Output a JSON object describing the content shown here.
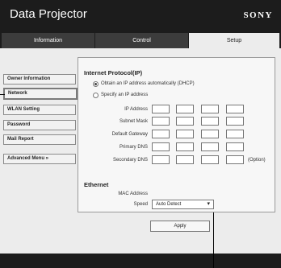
{
  "app": {
    "title": "Data Projector",
    "brand": "SONY"
  },
  "tabs": [
    {
      "label": "Information"
    },
    {
      "label": "Control"
    },
    {
      "label": "Setup"
    }
  ],
  "sidebar": {
    "items": [
      {
        "label": "Owner Information"
      },
      {
        "label": "Network"
      },
      {
        "label": "WLAN Setting"
      },
      {
        "label": "Password"
      },
      {
        "label": "Mail Report"
      },
      {
        "label": "Advanced Menu »"
      }
    ]
  },
  "ip": {
    "heading": "Internet Protocol(IP)",
    "opt_auto": "Obtain an IP address automatically (DHCP)",
    "opt_manual": "Specify an IP address",
    "fields": [
      {
        "label": "IP Address"
      },
      {
        "label": "Subnet Mask"
      },
      {
        "label": "Default Gateway"
      },
      {
        "label": "Primary DNS"
      },
      {
        "label": "Secondary DNS",
        "note": "(Option)"
      }
    ]
  },
  "ethernet": {
    "heading": "Ethernet",
    "mac_label": "MAC Address",
    "speed_label": "Speed",
    "speed_value": "Auto Detect"
  },
  "apply_label": "Apply"
}
